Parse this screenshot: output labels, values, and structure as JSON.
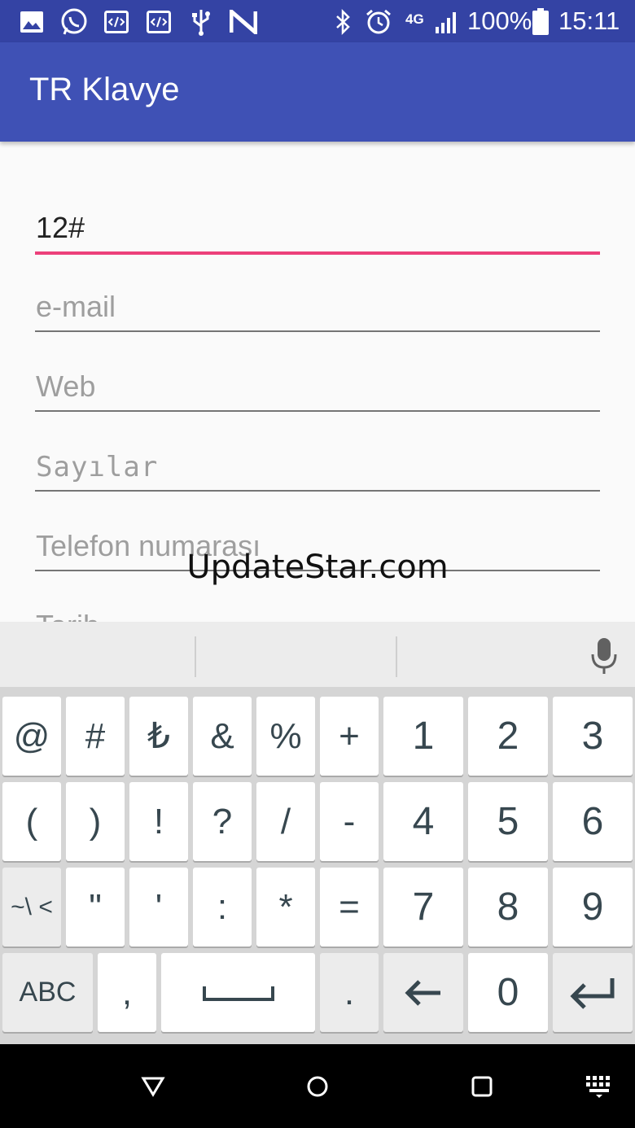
{
  "status_bar": {
    "battery_percent": "100%",
    "time": "15:11",
    "network": "4G",
    "icons": [
      "image-icon",
      "whatsapp-icon",
      "code-icon",
      "code-icon",
      "usb-icon",
      "n-icon",
      "bluetooth-icon",
      "alarm-icon",
      "signal-icon",
      "battery-icon"
    ]
  },
  "app_bar": {
    "title": "TR Klavye"
  },
  "form": {
    "fields": [
      {
        "value": "12#",
        "placeholder": ""
      },
      {
        "value": "",
        "placeholder": "e-mail"
      },
      {
        "value": "",
        "placeholder": "Web"
      },
      {
        "value": "",
        "placeholder": "Sayılar"
      },
      {
        "value": "",
        "placeholder": "Telefon numarası"
      },
      {
        "value": "",
        "placeholder": "Tarih"
      }
    ]
  },
  "watermark": "UpdateStar.com",
  "keyboard": {
    "suggestion_icons": [
      "microphone-icon"
    ],
    "rows": [
      [
        "@",
        "#",
        "₺",
        "&",
        "%",
        "+",
        "1",
        "2",
        "3"
      ],
      [
        "(",
        ")",
        "!",
        "?",
        "/",
        "-",
        "4",
        "5",
        "6"
      ],
      [
        "~\\ <",
        "\"",
        "'",
        ":",
        "*",
        "=",
        "7",
        "8",
        "9"
      ],
      [
        "ABC",
        ",",
        "",
        ".",
        "",
        "0",
        ""
      ]
    ],
    "icons": [
      "space-icon",
      "backspace-icon",
      "enter-icon"
    ],
    "colors": {
      "key_bg": "#ffffff",
      "keyboard_bg": "#d5d5d5",
      "key_text": "#37474f"
    }
  },
  "nav_bar": {
    "icons": [
      "back-icon",
      "home-icon",
      "recents-icon",
      "keyboard-switch-icon"
    ]
  },
  "colors": {
    "status_bar": "#3443a4",
    "app_bar": "#3f51b5",
    "focus_underline": "#ec407a"
  }
}
